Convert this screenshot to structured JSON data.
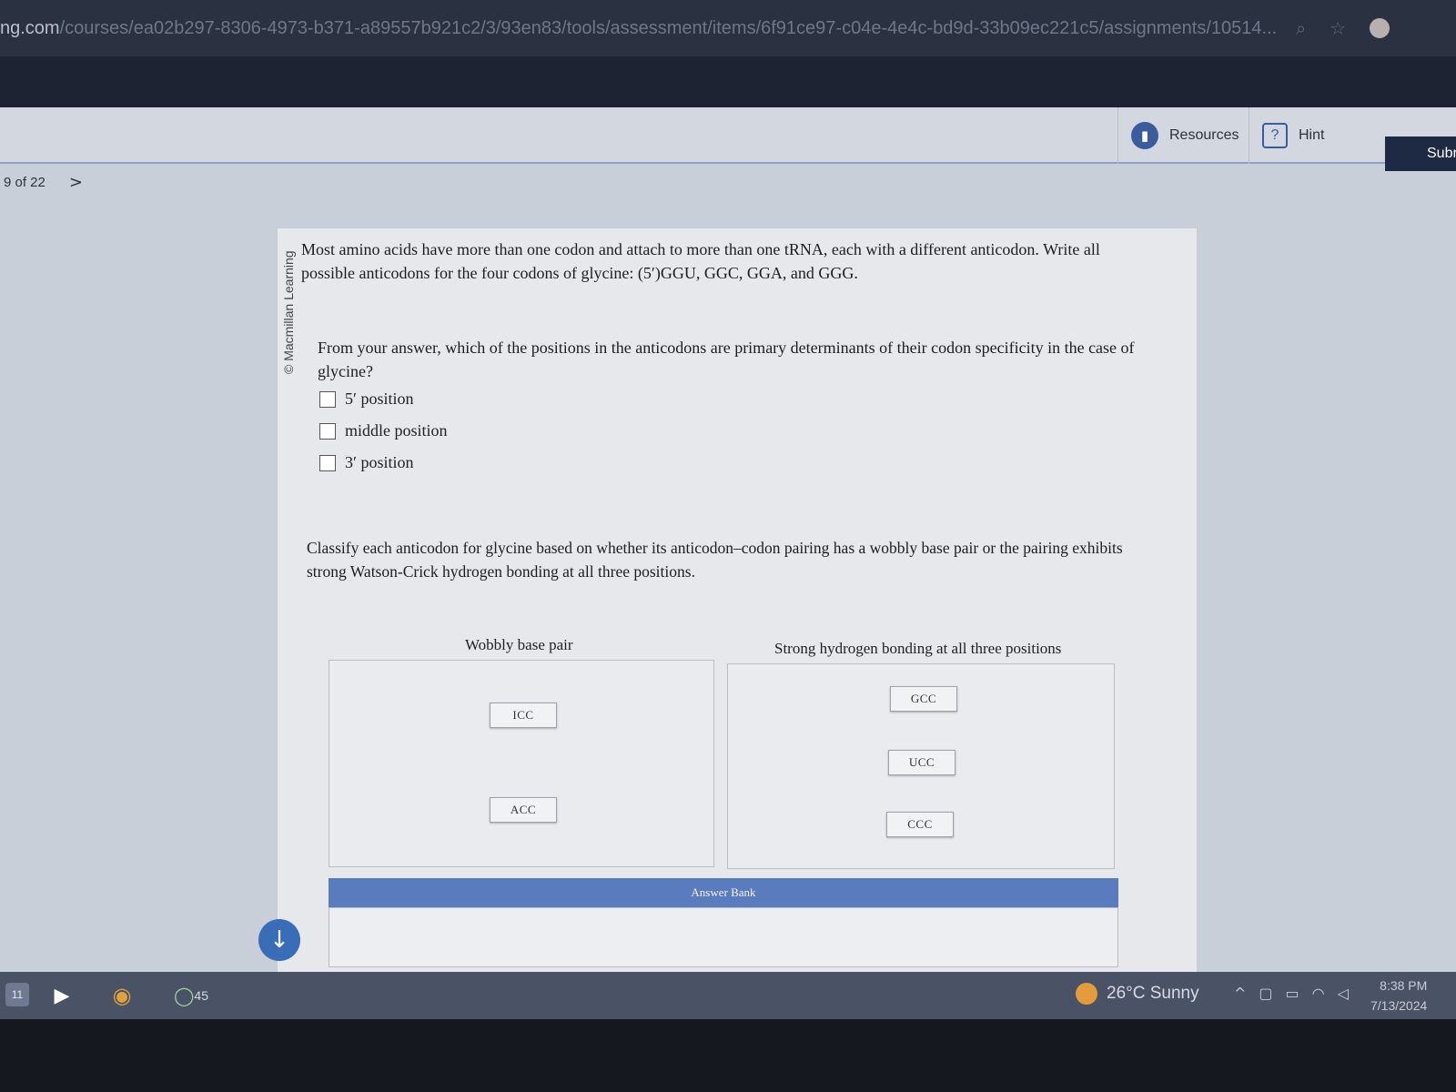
{
  "browser": {
    "url_host": "ng.com",
    "url_path": "/courses/ea02b297-8306-4973-b371-a89557b921c2/3/93en83/tools/assessment/items/6f91ce97-c04e-4e4c-bd9d-33b09ec221c5/assignments/10514..."
  },
  "toolbar": {
    "resources_label": "Resources",
    "hint_label": "Hint",
    "submit_label": "Subr"
  },
  "pager": {
    "text": "9 of 22",
    "next": ">"
  },
  "panel": {
    "credit": "© Macmillan Learning",
    "question1": "Most amino acids have more than one codon and attach to more than one tRNA, each with a different anticodon. Write all possible anticodons for the four codons of glycine: (5′)GGU, GGC, GGA, and GGG.",
    "question2": "From your answer, which of the positions in the anticodons are primary determinants of their codon specificity in the case of glycine?",
    "options": [
      {
        "label": "5′ position"
      },
      {
        "label": "middle position"
      },
      {
        "label": "3′ position"
      }
    ],
    "question3": "Classify each anticodon for glycine based on whether its anticodon–codon pairing has a wobbly base pair or the pairing exhibits strong Watson-Crick hydrogen bonding at all three positions.",
    "bins": {
      "wobbly": {
        "label": "Wobbly base pair",
        "chips": [
          "ICC",
          "ACC"
        ]
      },
      "strong": {
        "label": "Strong hydrogen bonding at all three positions",
        "chips": [
          "GCC",
          "UCC",
          "CCC"
        ]
      }
    },
    "answer_bank_label": "Answer Bank"
  },
  "taskbar": {
    "badge": "11",
    "chat_count": "45",
    "weather": "26°C  Sunny",
    "time": "8:38 PM",
    "date": "7/13/2024"
  },
  "colors": {
    "accent": "#5a7bbd",
    "submit": "#1e2a44",
    "scroll_button": "#3a6db8"
  }
}
